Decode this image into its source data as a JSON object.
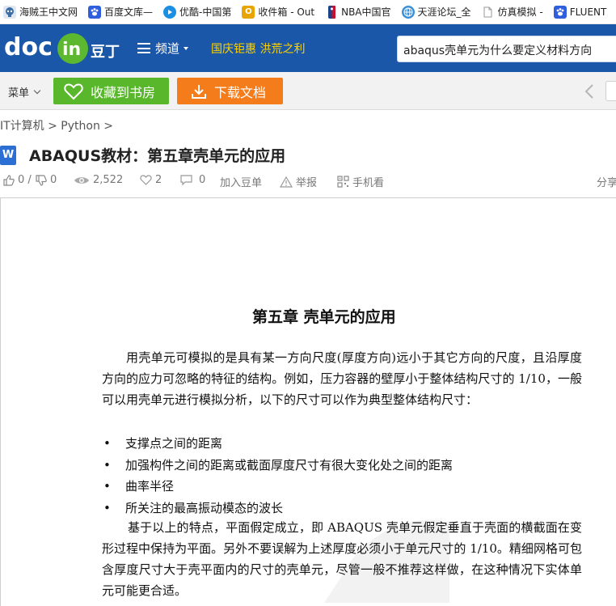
{
  "bookmarks": [
    {
      "label": "海贼王中文网",
      "icon": "skull-icon",
      "color": "#3a6ea5"
    },
    {
      "label": "百度文库—",
      "icon": "baidu-paw-icon",
      "color": "#2f5fdc"
    },
    {
      "label": "优酷-中国第",
      "icon": "youku-play-icon",
      "color": "#1a8fe3"
    },
    {
      "label": "收件箱 - Out",
      "icon": "outlook-icon",
      "color": "#e8a400"
    },
    {
      "label": "NBA中国官",
      "icon": "nba-icon",
      "color": "#d0202e"
    },
    {
      "label": "天涯论坛_全",
      "icon": "globe-icon",
      "color": "#3a8fd8"
    },
    {
      "label": "仿真模拟 -",
      "icon": "page-icon",
      "color": "#aaaaaa"
    },
    {
      "label": "FLUENT",
      "icon": "baidu-paw-icon",
      "color": "#2f5fdc"
    }
  ],
  "header": {
    "logo_text_left": "doc",
    "logo_text_badge": "in",
    "logo_text_cn": "豆丁",
    "channel_label": "频道",
    "promo_text": "国庆钜惠 洪荒之利",
    "search_value": "abaqus壳单元为什么要定义材料方向"
  },
  "toolbar": {
    "menu_label": "菜单",
    "fav_label": "收藏到书房",
    "download_label": "下载文档"
  },
  "breadcrumb": "IT计算机 > Python >",
  "document": {
    "title": "ABAQUS教材：第五章壳单元的应用",
    "stats": {
      "likes": "0 /",
      "dislikes": "0",
      "views": "2,522",
      "favorites": "2",
      "comments": "0",
      "add_label": "加入豆单",
      "report_label": "举报",
      "mobile_label": "手机看",
      "share_label": "分享"
    },
    "page": {
      "chapter_title": "第五章    壳单元的应用",
      "para1": "用壳单元可模拟的是具有某一方向尺度(厚度方向)远小于其它方向的尺度，且沿厚度方向的应力可忽略的特征的结构。例如，压力容器的壁厚小于整体结构尺寸的 1/10，一般可以用壳单元进行模拟分析，以下的尺寸可以作为典型整体结构尺寸：",
      "bullets": [
        "支撑点之间的距离",
        "加强构件之间的距离或截面厚度尺寸有很大变化处之间的距离",
        "曲率半径",
        "所关注的最高振动模态的波长"
      ],
      "para2": "基于以上的特点，平面假定成立，即 ABAQUS 壳单元假定垂直于壳面的横截面在变形过程中保持为平面。另外不要误解为上述厚度必须小于单元尺寸的 1/10。精细网格可包含厚度尺寸大于壳平面内的尺寸的壳单元，尽管一般不推荐这样做，在这种情况下实体单元可能更合适。"
    }
  },
  "colors": {
    "header_bg": "#1b57a8",
    "promo": "#ffd200",
    "fav_button": "#59b72c",
    "download_button": "#f57c1a"
  }
}
